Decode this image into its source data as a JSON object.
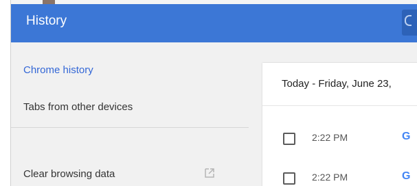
{
  "header": {
    "title": "History",
    "accent_color": "#3c77d6"
  },
  "sidebar": {
    "items": [
      {
        "label": "Chrome history",
        "active": true
      },
      {
        "label": "Tabs from other devices",
        "active": false
      },
      {
        "label": "Clear browsing data",
        "active": false,
        "icon": "open-in-new-icon"
      }
    ]
  },
  "card": {
    "date_header": "Today - Friday, June 23,",
    "entries": [
      {
        "time": "2:22 PM",
        "favicon": "G",
        "favicon_icon": "google-favicon-icon",
        "checked": false
      },
      {
        "time": "2:22 PM",
        "favicon": "G",
        "favicon_icon": "google-favicon-icon",
        "checked": false
      }
    ]
  },
  "colors": {
    "link_active": "#3367d6",
    "google_blue": "#4285f4"
  }
}
